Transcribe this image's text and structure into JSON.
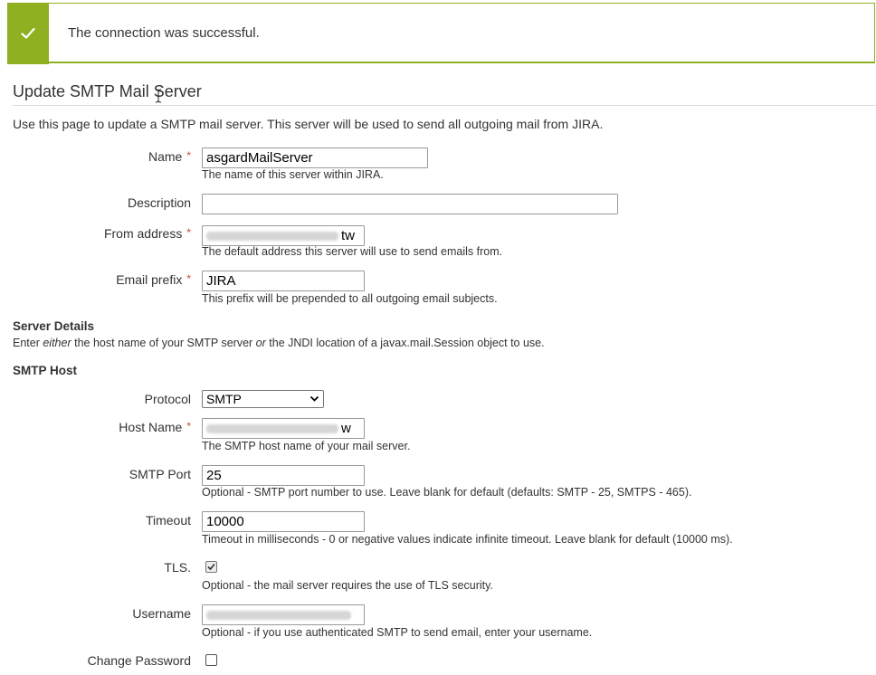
{
  "banner": {
    "icon": "checkmark-icon",
    "message": "The connection was successful.",
    "color": "#8eb021"
  },
  "page": {
    "title": "Update SMTP Mail Server",
    "intro": "Use this page to update a SMTP mail server. This server will be used to send all outgoing mail from JIRA."
  },
  "required_marker": "*",
  "fields": {
    "name": {
      "label": "Name",
      "value": "asgardMailServer",
      "description": "The name of this server within JIRA."
    },
    "description": {
      "label": "Description",
      "value": ""
    },
    "from_address": {
      "label": "From address",
      "value_visible_suffix": "tw",
      "description": "The default address this server will use to send emails from."
    },
    "email_prefix": {
      "label": "Email prefix",
      "value": "JIRA",
      "description": "This prefix will be prepended to all outgoing email subjects."
    }
  },
  "server_details": {
    "heading": "Server Details",
    "desc_pre": "Enter ",
    "desc_em1": "either",
    "desc_mid": " the host name of your SMTP server ",
    "desc_em2": "or",
    "desc_post": " the JNDI location of a javax.mail.Session object to use."
  },
  "smtp_host": {
    "heading": "SMTP Host",
    "protocol": {
      "label": "Protocol",
      "selected": "SMTP"
    },
    "host_name": {
      "label": "Host Name",
      "value_visible_suffix": "w",
      "description": "The SMTP host name of your mail server."
    },
    "smtp_port": {
      "label": "SMTP Port",
      "value": "25",
      "description": "Optional - SMTP port number to use. Leave blank for default (defaults: SMTP - 25, SMTPS - 465)."
    },
    "timeout": {
      "label": "Timeout",
      "value": "10000",
      "description": "Timeout in milliseconds - 0 or negative values indicate infinite timeout. Leave blank for default (10000 ms)."
    },
    "tls": {
      "label": "TLS.",
      "checked": true,
      "description": "Optional - the mail server requires the use of TLS security."
    },
    "username": {
      "label": "Username",
      "description": "Optional - if you use authenticated SMTP to send email, enter your username."
    },
    "change_password": {
      "label": "Change Password",
      "checked": false
    }
  }
}
